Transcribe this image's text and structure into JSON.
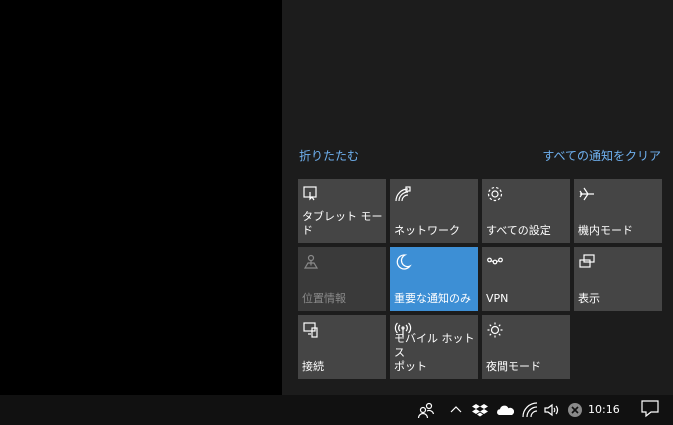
{
  "action_center": {
    "collapse_label": "折りたたむ",
    "clear_all_label": "すべての通知をクリア",
    "tiles": [
      {
        "label": "タブレット モード",
        "icon": "tablet-mode-icon",
        "state": "off"
      },
      {
        "label": "ネットワーク",
        "icon": "network-icon",
        "state": "off"
      },
      {
        "label": "すべての設定",
        "icon": "gear-icon",
        "state": "off"
      },
      {
        "label": "機内モード",
        "icon": "airplane-icon",
        "state": "off"
      },
      {
        "label": "位置情報",
        "icon": "location-icon",
        "state": "disabled"
      },
      {
        "label": "重要な通知のみ",
        "icon": "moon-icon",
        "state": "on"
      },
      {
        "label": "VPN",
        "icon": "vpn-icon",
        "state": "off"
      },
      {
        "label": "表示",
        "icon": "display-icon",
        "state": "off"
      },
      {
        "label": "接続",
        "icon": "connect-icon",
        "state": "off"
      },
      {
        "label": "モバイル ホットス\nポット",
        "icon": "hotspot-icon",
        "state": "off"
      },
      {
        "label": "夜間モード",
        "icon": "brightness-icon",
        "state": "off"
      }
    ]
  },
  "taskbar": {
    "clock": "10:16",
    "tray_icons": [
      "people-icon",
      "chevron-up-icon",
      "dropbox-icon",
      "onedrive-icon",
      "wifi-icon",
      "volume-icon",
      "close-circle-icon"
    ]
  },
  "colors": {
    "accent": "#3d8fd5",
    "link": "#6fb1f0",
    "tile": "#454545",
    "panel": "#1c1c1c"
  }
}
